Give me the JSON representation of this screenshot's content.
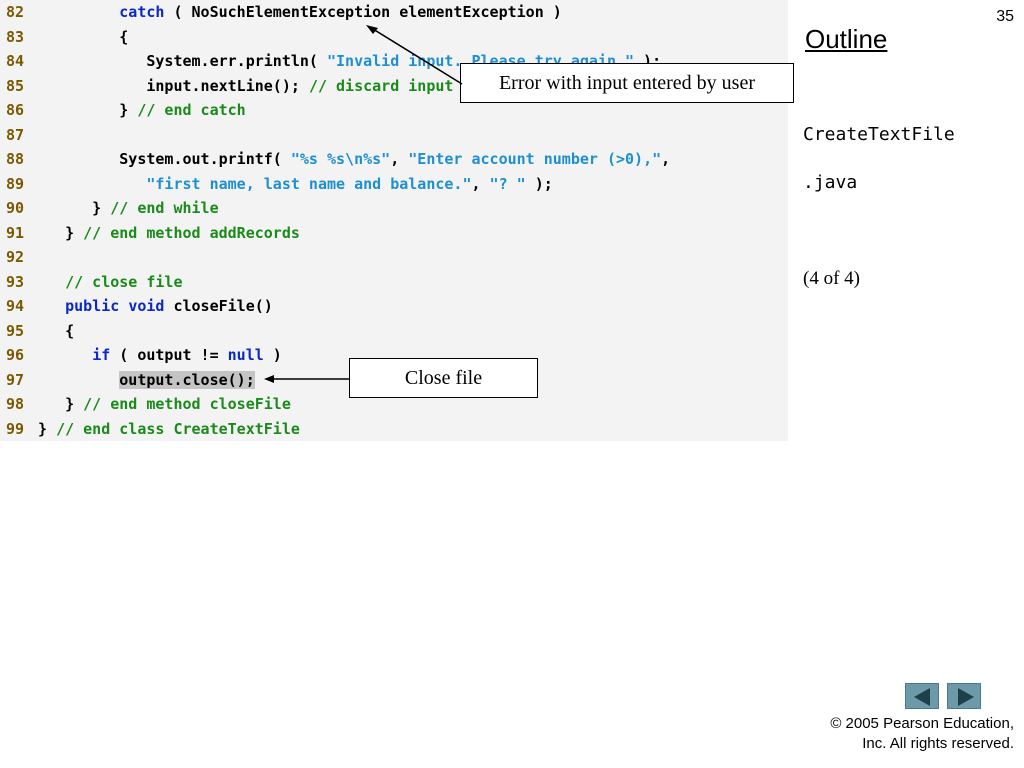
{
  "slide_number": "35",
  "outline": {
    "title": "Outline",
    "file_name": "CreateTextFile",
    "file_ext": ".java",
    "page_indicator": "(4 of 4)"
  },
  "code_lines": [
    {
      "num": "82",
      "segments": [
        {
          "t": "         ",
          "c": "p"
        },
        {
          "t": "catch",
          "c": "kw"
        },
        {
          "t": " ( NoSuchElementException elementException )",
          "c": "p"
        }
      ]
    },
    {
      "num": "83",
      "segments": [
        {
          "t": "         {",
          "c": "p"
        }
      ]
    },
    {
      "num": "84",
      "segments": [
        {
          "t": "            System.err.println( ",
          "c": "p"
        },
        {
          "t": "\"Invalid input. Please try again.\"",
          "c": "str"
        },
        {
          "t": " );",
          "c": "p"
        }
      ]
    },
    {
      "num": "85",
      "segments": [
        {
          "t": "            input.nextLine(); ",
          "c": "p"
        },
        {
          "t": "// discard input so user can try again",
          "c": "cmt"
        }
      ]
    },
    {
      "num": "86",
      "segments": [
        {
          "t": "         } ",
          "c": "p"
        },
        {
          "t": "// end catch",
          "c": "cmt"
        }
      ]
    },
    {
      "num": "87",
      "segments": [
        {
          "t": "",
          "c": "p"
        }
      ]
    },
    {
      "num": "88",
      "segments": [
        {
          "t": "         System.out.printf( ",
          "c": "p"
        },
        {
          "t": "\"%s %s\\n%s\"",
          "c": "str"
        },
        {
          "t": ", ",
          "c": "p"
        },
        {
          "t": "\"Enter account number (>0),\"",
          "c": "str"
        },
        {
          "t": ",",
          "c": "p"
        }
      ]
    },
    {
      "num": "89",
      "segments": [
        {
          "t": "            ",
          "c": "p"
        },
        {
          "t": "\"first name, last name and balance.\"",
          "c": "str"
        },
        {
          "t": ", ",
          "c": "p"
        },
        {
          "t": "\"? \"",
          "c": "str"
        },
        {
          "t": " );",
          "c": "p"
        }
      ]
    },
    {
      "num": "90",
      "segments": [
        {
          "t": "      } ",
          "c": "p"
        },
        {
          "t": "// end while",
          "c": "cmt"
        }
      ]
    },
    {
      "num": "91",
      "segments": [
        {
          "t": "   } ",
          "c": "p"
        },
        {
          "t": "// end method addRecords",
          "c": "cmt"
        }
      ]
    },
    {
      "num": "92",
      "segments": [
        {
          "t": "",
          "c": "p"
        }
      ]
    },
    {
      "num": "93",
      "segments": [
        {
          "t": "   ",
          "c": "p"
        },
        {
          "t": "// close file",
          "c": "cmt"
        }
      ]
    },
    {
      "num": "94",
      "segments": [
        {
          "t": "   ",
          "c": "p"
        },
        {
          "t": "public",
          "c": "kw"
        },
        {
          "t": " ",
          "c": "p"
        },
        {
          "t": "void",
          "c": "kw"
        },
        {
          "t": " closeFile()",
          "c": "p"
        }
      ]
    },
    {
      "num": "95",
      "segments": [
        {
          "t": "   {",
          "c": "p"
        }
      ]
    },
    {
      "num": "96",
      "segments": [
        {
          "t": "      ",
          "c": "p"
        },
        {
          "t": "if",
          "c": "kw"
        },
        {
          "t": " ( output != ",
          "c": "p"
        },
        {
          "t": "null",
          "c": "kw"
        },
        {
          "t": " )",
          "c": "p"
        }
      ]
    },
    {
      "num": "97",
      "segments": [
        {
          "t": "         ",
          "c": "p"
        },
        {
          "t": "output.close();",
          "c": "hl"
        }
      ]
    },
    {
      "num": "98",
      "segments": [
        {
          "t": "   } ",
          "c": "p"
        },
        {
          "t": "// end method closeFile",
          "c": "cmt"
        }
      ]
    },
    {
      "num": "99",
      "segments": [
        {
          "t": "} ",
          "c": "p"
        },
        {
          "t": "// end class CreateTextFile",
          "c": "cmt"
        }
      ]
    }
  ],
  "callouts": {
    "error": "Error with input entered by user",
    "close": "Close file"
  },
  "nav": {
    "prev_icon": "triangle-left-icon",
    "next_icon": "triangle-right-icon",
    "color": "#6d9aa8"
  },
  "copyright": {
    "line1": "© 2005 Pearson Education,",
    "line2": "Inc.  All rights reserved."
  }
}
